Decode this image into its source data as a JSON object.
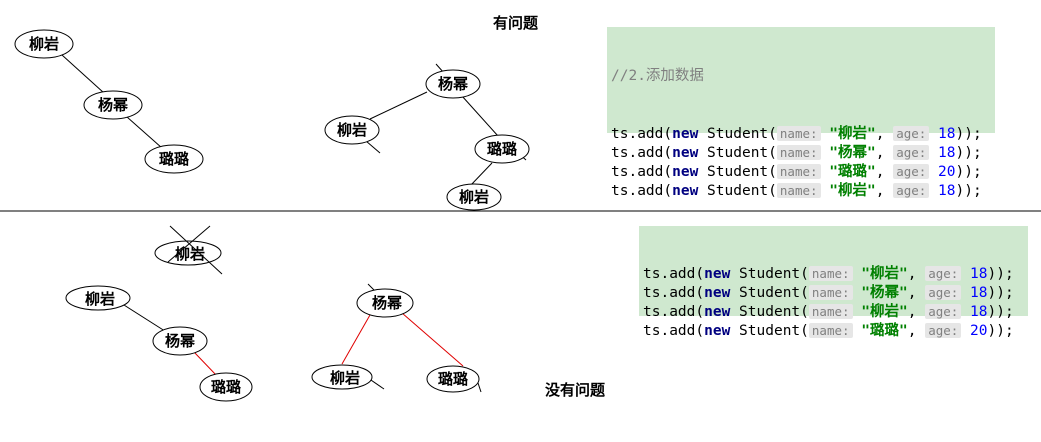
{
  "top": {
    "heading": "有问题",
    "code_comment": "//2.添加数据",
    "code_lines": [
      {
        "prefix": "ts.add(",
        "kw": "new",
        "cls": " Student(",
        "hint1": "name:",
        "str": "\"柳岩\"",
        "sep": ", ",
        "hint2": "age:",
        "num": "18",
        "suffix": "));"
      },
      {
        "prefix": "ts.add(",
        "kw": "new",
        "cls": " Student(",
        "hint1": "name:",
        "str": "\"杨幂\"",
        "sep": ", ",
        "hint2": "age:",
        "num": "18",
        "suffix": "));"
      },
      {
        "prefix": "ts.add(",
        "kw": "new",
        "cls": " Student(",
        "hint1": "name:",
        "str": "\"璐璐\"",
        "sep": ", ",
        "hint2": "age:",
        "num": "20",
        "suffix": "));"
      },
      {
        "prefix": "ts.add(",
        "kw": "new",
        "cls": " Student(",
        "hint1": "name:",
        "str": "\"柳岩\"",
        "sep": ", ",
        "hint2": "age:",
        "num": "18",
        "suffix": "));"
      }
    ],
    "tree_a": {
      "nodes": [
        "柳岩",
        "杨幂",
        "璐璐"
      ]
    },
    "tree_b": {
      "nodes": [
        "杨幂",
        "柳岩",
        "璐璐",
        "柳岩"
      ]
    }
  },
  "bottom": {
    "heading": "没有问题",
    "code_lines": [
      {
        "prefix": "ts.add(",
        "kw": "new",
        "cls": " Student(",
        "hint1": "name:",
        "str": "\"柳岩\"",
        "sep": ", ",
        "hint2": "age:",
        "num": "18",
        "suffix": "));"
      },
      {
        "prefix": "ts.add(",
        "kw": "new",
        "cls": " Student(",
        "hint1": "name:",
        "str": "\"杨幂\"",
        "sep": ", ",
        "hint2": "age:",
        "num": "18",
        "suffix": "));"
      },
      {
        "prefix": "ts.add(",
        "kw": "new",
        "cls": " Student(",
        "hint1": "name:",
        "str": "\"柳岩\"",
        "sep": ", ",
        "hint2": "age:",
        "num": "18",
        "suffix": "));"
      },
      {
        "prefix": "ts.add(",
        "kw": "new",
        "cls": " Student(",
        "hint1": "name:",
        "str": "\"璐璐\"",
        "sep": ", ",
        "hint2": "age:",
        "num": "20",
        "suffix": "));"
      }
    ],
    "tree_a": {
      "nodes": [
        "柳岩",
        "柳岩",
        "杨幂",
        "璐璐"
      ]
    },
    "tree_b": {
      "nodes": [
        "杨幂",
        "柳岩",
        "璐璐"
      ]
    }
  },
  "colors": {
    "code_bg": "#cfe8cf",
    "red_edge": "#e00000"
  }
}
